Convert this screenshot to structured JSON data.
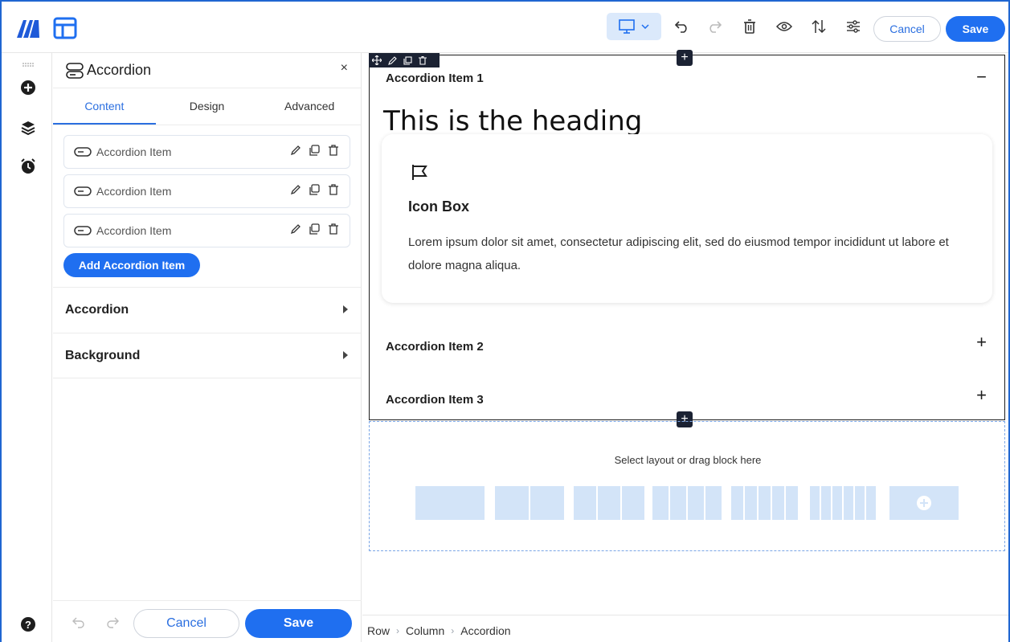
{
  "topbar": {
    "cancel_label": "Cancel",
    "save_label": "Save"
  },
  "panel": {
    "title": "Accordion",
    "close": "×",
    "tabs": [
      {
        "label": "Content",
        "active": true
      },
      {
        "label": "Design",
        "active": false
      },
      {
        "label": "Advanced",
        "active": false
      }
    ],
    "items": [
      {
        "label": "Accordion Item"
      },
      {
        "label": "Accordion Item"
      },
      {
        "label": "Accordion Item"
      }
    ],
    "add_label": "Add Accordion Item",
    "sections": [
      {
        "label": "Accordion"
      },
      {
        "label": "Background"
      }
    ],
    "footer": {
      "cancel_label": "Cancel",
      "save_label": "Save"
    }
  },
  "canvas": {
    "accordion": {
      "items": [
        {
          "title": "Accordion Item 1",
          "sign": "−"
        },
        {
          "title": "Accordion Item 2",
          "sign": "+"
        },
        {
          "title": "Accordion Item 3",
          "sign": "+"
        }
      ],
      "heading": "This is the heading",
      "icon_box": {
        "title": "Icon Box",
        "text": "Lorem ipsum dolor sit amet, consectetur adipiscing elit, sed do eiusmod tempor incididunt ut labore et dolore magna aliqua."
      }
    },
    "dropzone_text": "Select layout or drag block here",
    "breadcrumb": [
      "Row",
      "Column",
      "Accordion"
    ]
  },
  "colors": {
    "accent": "#1f6ff0",
    "dark": "#1b2233",
    "layout_block": "#d3e4f8"
  }
}
